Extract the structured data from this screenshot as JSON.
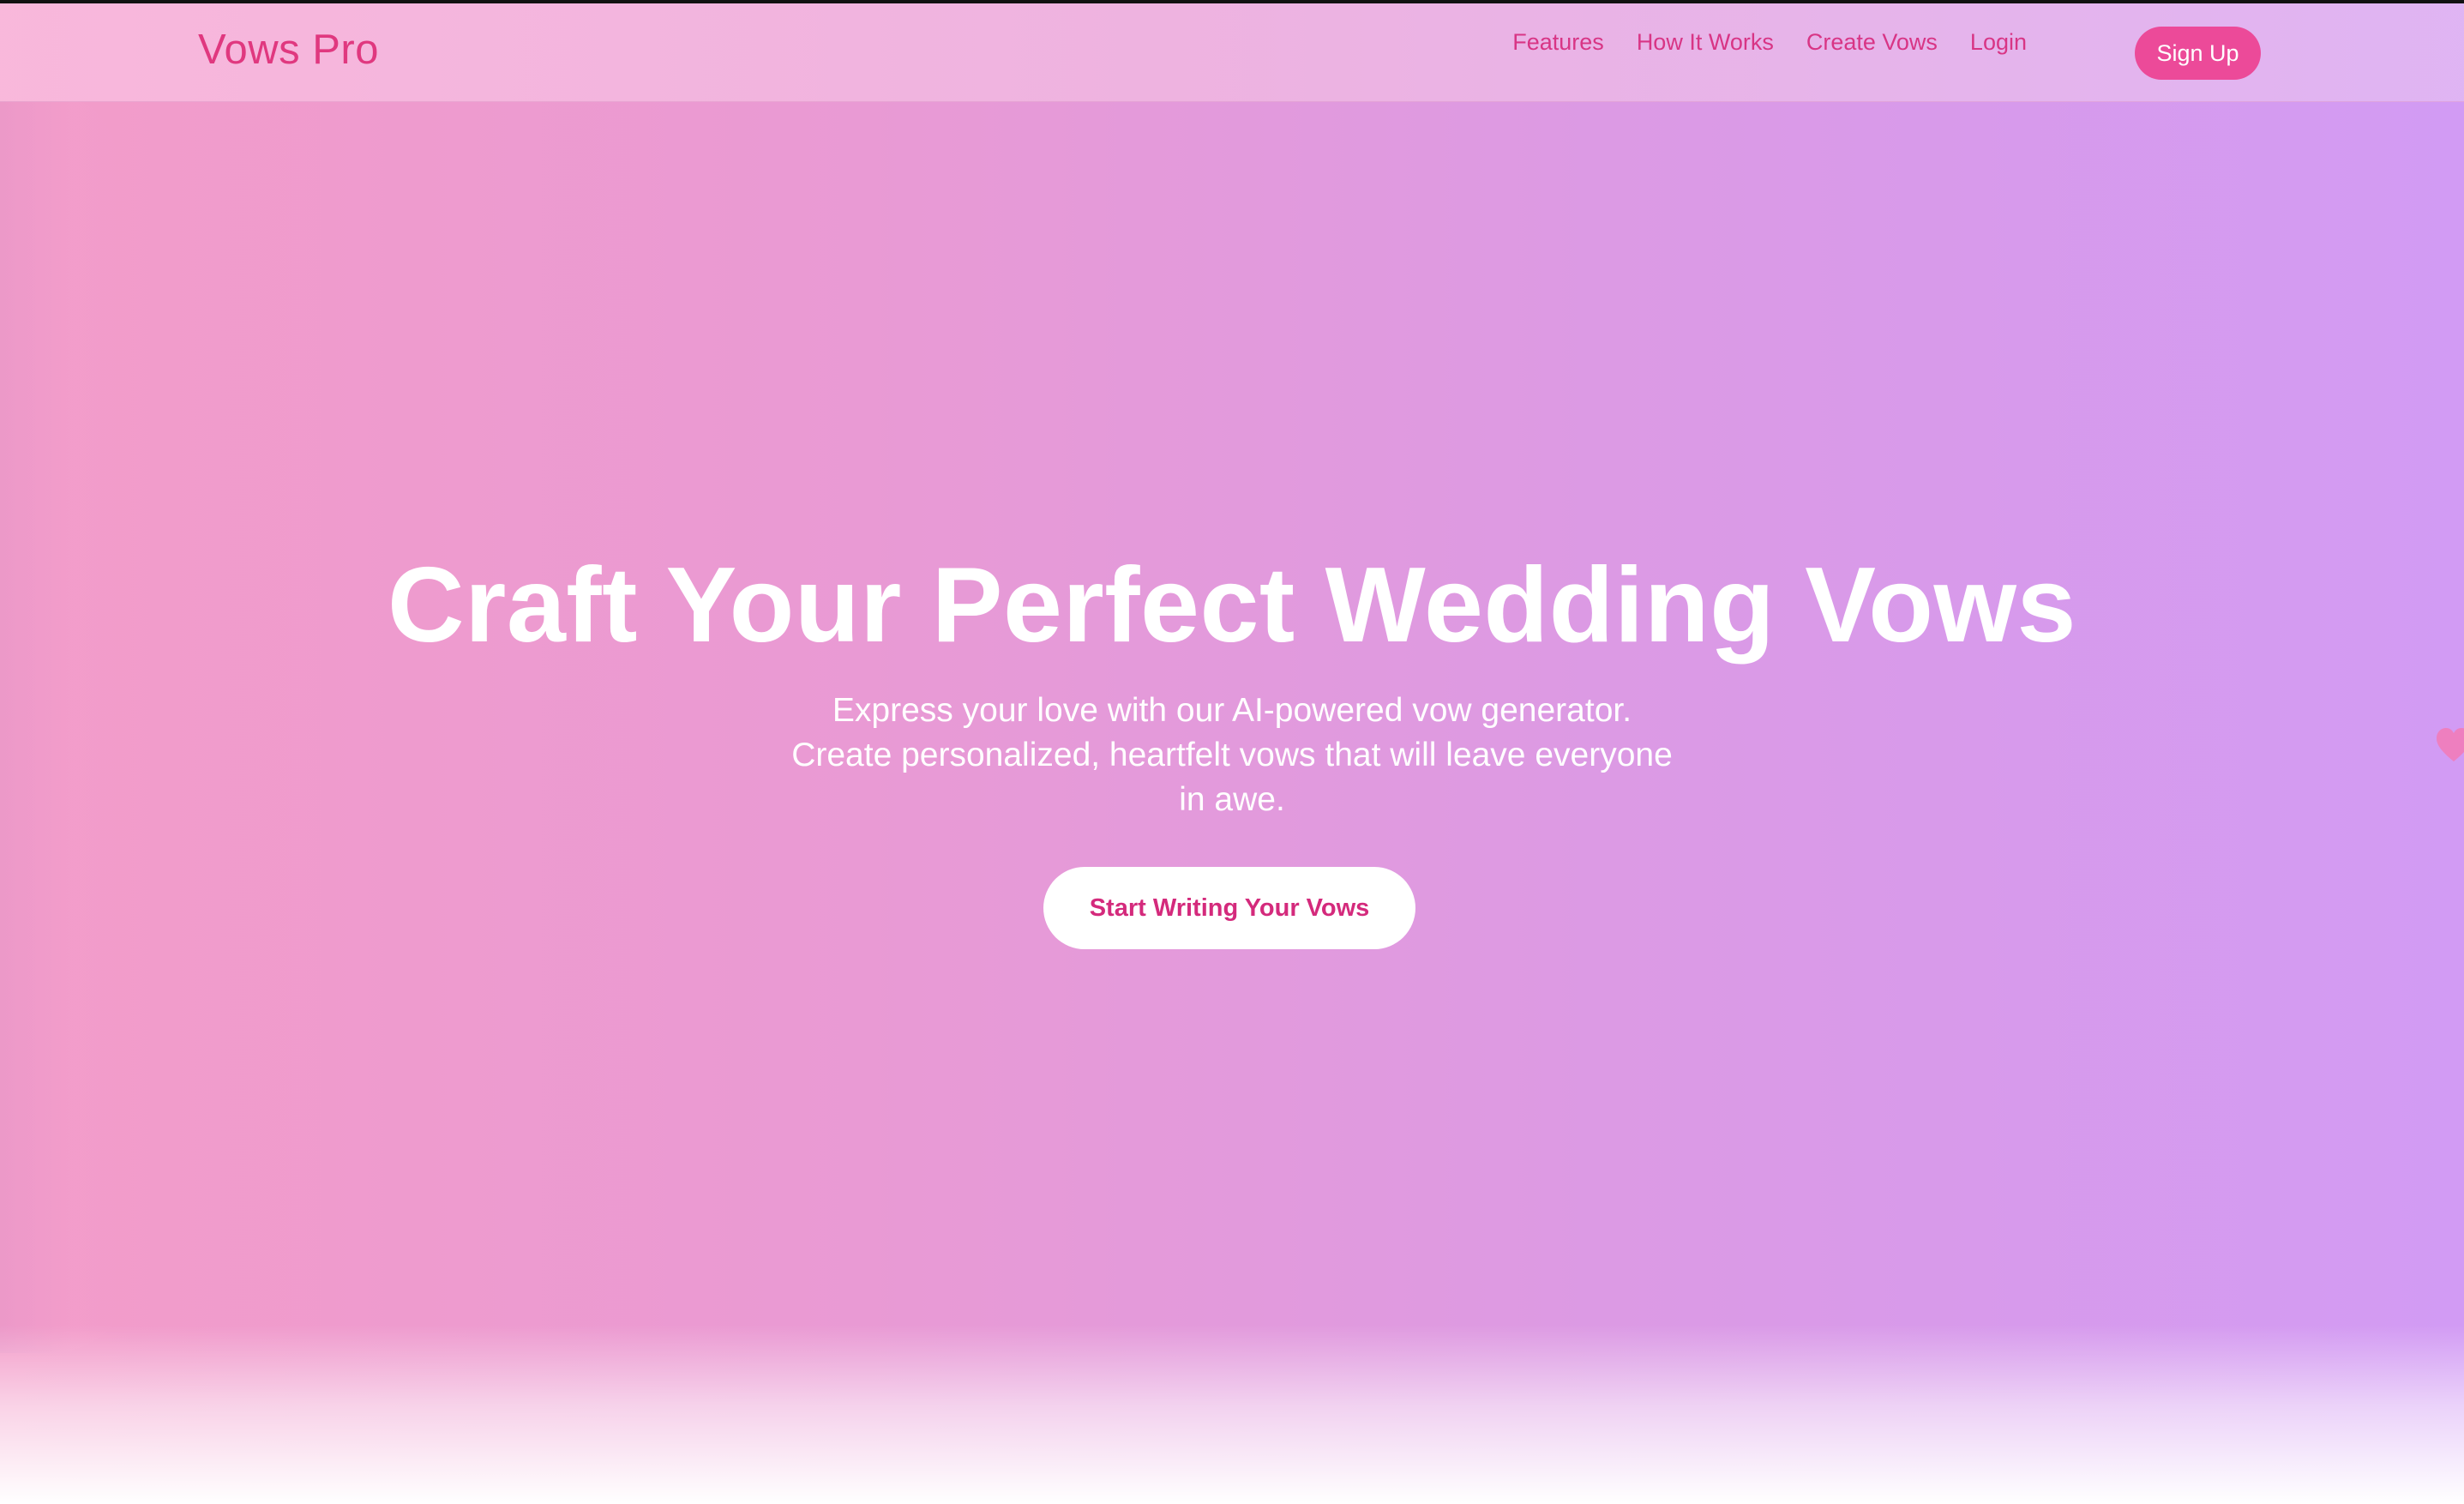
{
  "header": {
    "logo": "Vows Pro",
    "nav": [
      {
        "label": "Features"
      },
      {
        "label": "How It Works"
      },
      {
        "label": "Create Vows"
      },
      {
        "label": "Login"
      }
    ],
    "signup_label": "Sign Up"
  },
  "hero": {
    "title": "Craft Your Perfect Wedding Vows",
    "subtitle": "Express your love with our AI-powered vow generator. Create personalized, heartfelt vows that will leave everyone in awe.",
    "cta_label": "Start Writing Your Vows"
  },
  "colors": {
    "brand_pink": "#e0387f",
    "signup_bg": "#ec4a99",
    "gradient_start": "#f39cc9",
    "gradient_end": "#d29bf4",
    "cta_text": "#d42a7c"
  },
  "icons": {
    "decorative": "heart-icon"
  }
}
